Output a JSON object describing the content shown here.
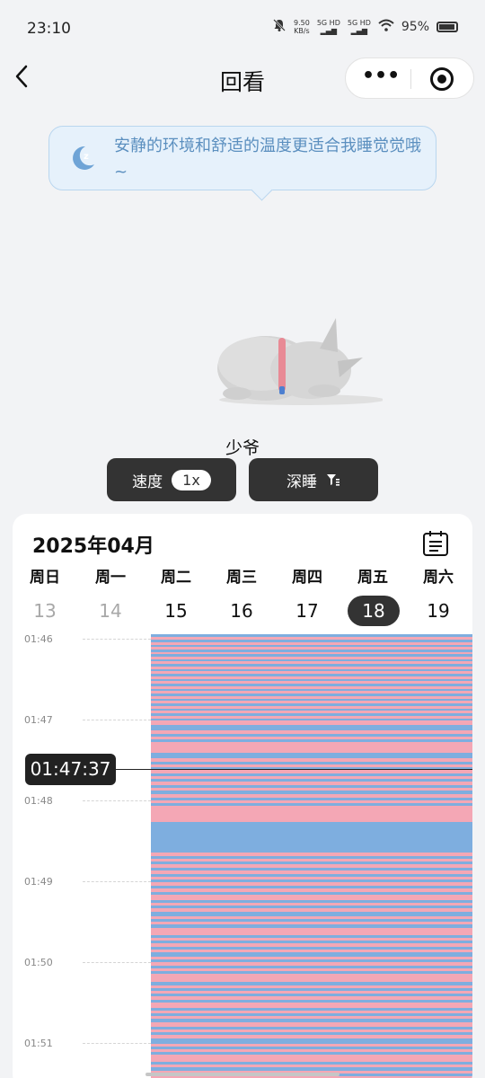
{
  "status_bar": {
    "time": "23:10",
    "net_speed": "9.50",
    "net_unit": "KB/s",
    "sim1": "5G HD",
    "sim2": "5G HD",
    "battery": "95%"
  },
  "nav": {
    "title": "回看"
  },
  "bubble": {
    "text": "安静的环境和舒适的温度更适合我睡觉觉哦~"
  },
  "pet": {
    "name": "少爷"
  },
  "controls": {
    "speed_label": "速度",
    "speed_value": "1x",
    "filter_label": "深睡"
  },
  "calendar": {
    "month": "2025年04月",
    "weekdays": [
      "周日",
      "周一",
      "周二",
      "周三",
      "周四",
      "周五",
      "周六"
    ],
    "days": [
      "13",
      "14",
      "15",
      "16",
      "17",
      "18",
      "19"
    ],
    "selected_day": "18"
  },
  "timeline": {
    "labels": [
      "01:46",
      "01:47",
      "01:48",
      "01:49",
      "01:50",
      "01:51"
    ],
    "current_time": "01:47:37",
    "colors": {
      "pink": "#f4a7b5",
      "blue": "#7eaedf"
    }
  }
}
